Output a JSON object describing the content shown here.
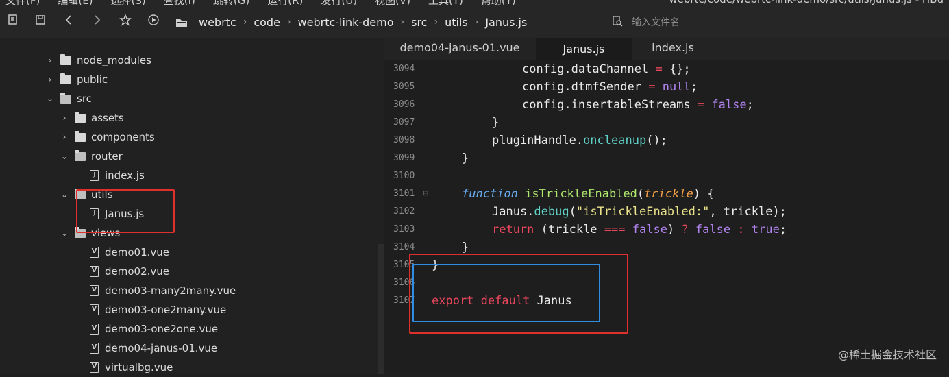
{
  "menubar": {
    "items": [
      "文件(F)",
      "编辑(E)",
      "选择(S)",
      "查找(I)",
      "跳转(G)",
      "运行(R)",
      "发行(U)",
      "视图(V)",
      "工具(T)",
      "帮助(Y)"
    ],
    "window_title": "webrtc/code/webrtc-link-demo/src/utils/Janus.js - HBu"
  },
  "toolbar": {
    "breadcrumb": [
      "webrtc",
      "code",
      "webrtc-link-demo",
      "src",
      "utils",
      "Janus.js"
    ],
    "search_placeholder": "输入文件名"
  },
  "sidebar": {
    "tree": [
      {
        "label": "node_modules",
        "type": "folder",
        "expanded": false
      },
      {
        "label": "public",
        "type": "folder",
        "expanded": false
      },
      {
        "label": "src",
        "type": "folder",
        "expanded": true
      },
      {
        "label": "assets",
        "type": "folder",
        "expanded": false
      },
      {
        "label": "components",
        "type": "folder",
        "expanded": false
      },
      {
        "label": "router",
        "type": "folder",
        "expanded": true
      },
      {
        "label": "index.js",
        "type": "js"
      },
      {
        "label": "utils",
        "type": "folder",
        "expanded": true
      },
      {
        "label": "Janus.js",
        "type": "js"
      },
      {
        "label": "views",
        "type": "folder",
        "expanded": true
      },
      {
        "label": "demo01.vue",
        "type": "vue"
      },
      {
        "label": "demo02.vue",
        "type": "vue"
      },
      {
        "label": "demo03-many2many.vue",
        "type": "vue"
      },
      {
        "label": "demo03-one2many.vue",
        "type": "vue"
      },
      {
        "label": "demo03-one2one.vue",
        "type": "vue"
      },
      {
        "label": "demo04-janus-01.vue",
        "type": "vue"
      },
      {
        "label": "virtualbg.vue",
        "type": "vue"
      }
    ]
  },
  "editor": {
    "tabs": [
      {
        "label": "demo04-janus-01.vue",
        "active": false
      },
      {
        "label": "Janus.js",
        "active": true
      },
      {
        "label": "index.js",
        "active": false
      }
    ],
    "line_numbers": [
      "3094",
      "3095",
      "3096",
      "3097",
      "3098",
      "3099",
      "3100",
      "3101",
      "3102",
      "3103",
      "3104",
      "3105",
      "3106",
      "3107"
    ],
    "code": {
      "l3094": {
        "a": "config.dataChannel ",
        "b": "=",
        "c": " {};"
      },
      "l3095": {
        "a": "config.dtmfSender ",
        "b": "=",
        "c": " ",
        "d": "null",
        "e": ";"
      },
      "l3096": {
        "a": "config.insertableStreams ",
        "b": "=",
        "c": " ",
        "d": "false",
        "e": ";"
      },
      "l3097": {
        "a": "}"
      },
      "l3098": {
        "a": "pluginHandle.",
        "b": "oncleanup",
        "c": "();"
      },
      "l3099": {
        "a": "}"
      },
      "l3101": {
        "a": "function",
        "b": " ",
        "c": "isTrickleEnabled",
        "d": "(",
        "e": "trickle",
        "f": ") {"
      },
      "l3102": {
        "a": "Janus.",
        "b": "debug",
        "c": "(",
        "d": "\"isTrickleEnabled:\"",
        "e": ", trickle);"
      },
      "l3103": {
        "a": "return",
        "b": " (trickle ",
        "c": "===",
        "d": " ",
        "e": "false",
        "f": ") ",
        "g": "?",
        "h": " ",
        "i": "false",
        "j": " ",
        "k": ":",
        "l": " ",
        "m": "true",
        "n": ";"
      },
      "l3104": {
        "a": "}"
      },
      "l3105": {
        "a": "}"
      },
      "l3107": {
        "a": "export",
        "b": " ",
        "c": "default",
        "d": " Janus"
      }
    }
  },
  "watermark": "@稀土掘金技术社区",
  "colors": {
    "annotation_red": "#e0302e",
    "annotation_blue": "#2f8de4",
    "keyword": "#e8465c",
    "function_name": "#aee86f",
    "boolean": "#b184f0",
    "string": "#e9e28a"
  }
}
